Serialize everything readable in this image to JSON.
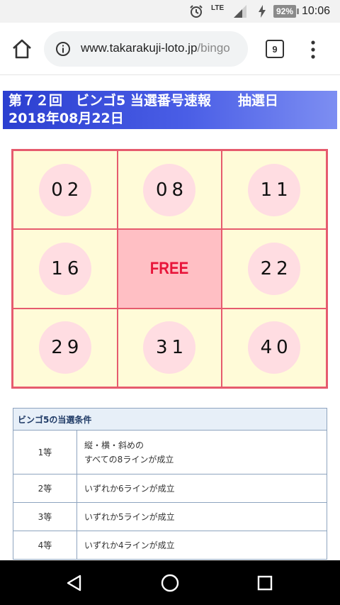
{
  "status_bar": {
    "network": "LTE",
    "battery": "92%",
    "time": "10:06",
    "icons": [
      "alarm-icon",
      "signal-icon",
      "charging-icon",
      "battery-icon"
    ]
  },
  "browser": {
    "url_host": "www.takarakuji-loto.jp",
    "url_path": "/bingo",
    "tab_count": "9",
    "icons": [
      "home-icon",
      "info-icon",
      "menu-icon"
    ]
  },
  "banner": {
    "line1": "第７２回　ビンゴ5 当選番号速報　　抽選日",
    "line2": "2018年08月22日"
  },
  "bingo": {
    "cells": [
      {
        "value": "02"
      },
      {
        "value": "08"
      },
      {
        "value": "11"
      },
      {
        "value": "16"
      },
      {
        "value": "FREE"
      },
      {
        "value": "22"
      },
      {
        "value": "29"
      },
      {
        "value": "31"
      },
      {
        "value": "40"
      }
    ],
    "colors": {
      "border": "#e65b6e",
      "cell_bg": "#fffbd8",
      "ball_bg": "#ffdde2",
      "free_bg": "#ffbfc4",
      "free_text": "#e8153a"
    }
  },
  "conditions": {
    "caption": "ビンゴ5の当選条件",
    "rows": [
      {
        "rank": "1等",
        "desc_line1": "縦・横・斜めの",
        "desc_line2": "すべての8ラインが成立"
      },
      {
        "rank": "2等",
        "desc": "いずれか6ラインが成立"
      },
      {
        "rank": "3等",
        "desc": "いずれか5ラインが成立"
      },
      {
        "rank": "4等",
        "desc": "いずれか4ラインが成立"
      }
    ]
  },
  "nav": {
    "icons": [
      "back-icon",
      "home-icon",
      "recents-icon"
    ]
  }
}
